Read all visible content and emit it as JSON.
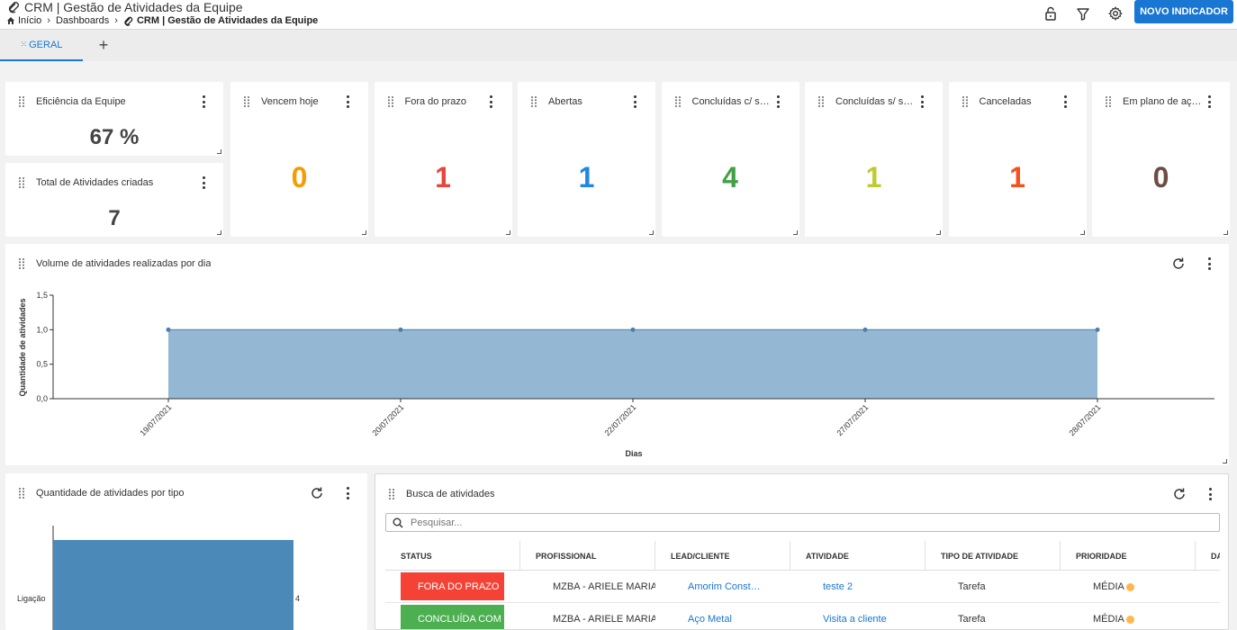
{
  "header": {
    "title": "CRM | Gestão de Atividades da Equipe",
    "breadcrumb": [
      {
        "label": "Início"
      },
      {
        "label": "Dashboards"
      },
      {
        "label": "CRM | Gestão de Atividades da Equipe"
      }
    ],
    "new_indicator_label": "NOVO INDICADOR",
    "icons": [
      "lock-icon",
      "filter-icon",
      "gear-icon"
    ]
  },
  "tabs": [
    {
      "label": "GERAL",
      "active": true
    }
  ],
  "kpis": {
    "efficiency": {
      "title": "Eficiência da Equipe",
      "value": "67 %"
    },
    "total_created": {
      "title": "Total de Atividades criadas",
      "value": "7"
    },
    "tiles": [
      {
        "title": "Vencem hoje",
        "value": "0",
        "color": "#f59c00"
      },
      {
        "title": "Fora do prazo",
        "value": "1",
        "color": "#e8453c"
      },
      {
        "title": "Abertas",
        "value": "1",
        "color": "#1e88e5"
      },
      {
        "title": "Concluídas c/ s…",
        "value": "4",
        "color": "#43a047"
      },
      {
        "title": "Concluídas s/ s…",
        "value": "1",
        "color": "#c0ca33"
      },
      {
        "title": "Canceladas",
        "value": "1",
        "color": "#f4511e"
      },
      {
        "title": "Em plano de aç…",
        "value": "0",
        "color": "#6d4c41"
      }
    ]
  },
  "volume_chart": {
    "title": "Volume de atividades realizadas por dia"
  },
  "type_chart": {
    "title": "Quantidade de atividades por tipo"
  },
  "chart_data": [
    {
      "type": "area",
      "x": [
        "19/07/2021",
        "20/07/2021",
        "22/07/2021",
        "27/07/2021",
        "28/07/2021"
      ],
      "series": [
        {
          "values": [
            1,
            1,
            1,
            1,
            1
          ]
        }
      ],
      "xlabel": "Dias",
      "ylabel": "Quantidade de atividades",
      "ylim": [
        0,
        1.5
      ],
      "yticks": [
        "0,0",
        "0,5",
        "1,0",
        "1,5"
      ],
      "color": "#94b8d4"
    },
    {
      "type": "bar",
      "orientation": "horizontal",
      "categories": [
        "Ligação"
      ],
      "values": [
        4
      ],
      "color": "#4a89b8"
    }
  ],
  "search": {
    "title": "Busca de atividades",
    "placeholder": "Pesquisar...",
    "columns": [
      "STATUS",
      "PROFISSIONAL",
      "LEAD/CLIENTE",
      "ATIVIDADE",
      "TIPO DE ATIVIDADE",
      "PRIORIDADE",
      "DA"
    ],
    "rows": [
      {
        "status": "FORA DO PRAZO",
        "status_color": "#f44336",
        "professional": "MZBA - ARIELE MARIA C",
        "lead": "Amorim Const…",
        "activity": "teste 2",
        "type": "Tarefa",
        "priority": "MÉDIA",
        "priority_color": "#ffb74d"
      },
      {
        "status": "CONCLUÍDA COM SUCESSO",
        "status_color": "#4caf50",
        "professional": "MZBA - ARIELE MARIA C",
        "lead": "Aço Metal",
        "activity": "Visita a cliente",
        "type": "Tarefa",
        "priority": "MÉDIA",
        "priority_color": "#ffb74d"
      }
    ]
  }
}
